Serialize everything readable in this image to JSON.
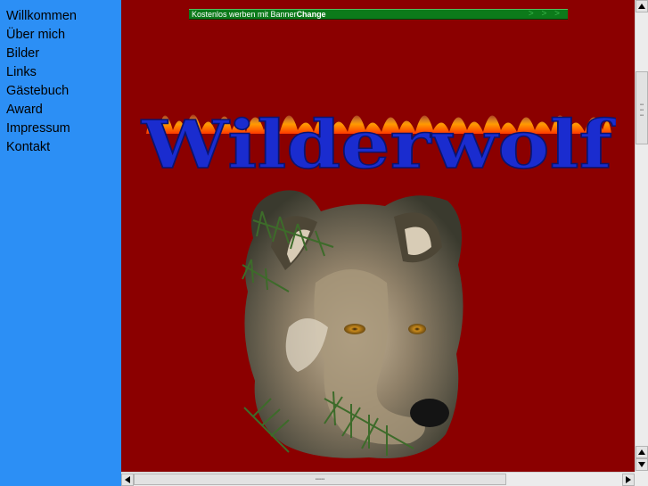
{
  "nav": {
    "items": [
      {
        "label": "Willkommen"
      },
      {
        "label": "Über mich"
      },
      {
        "label": "Bilder"
      },
      {
        "label": "Links"
      },
      {
        "label": "Gästebuch"
      },
      {
        "label": "Award"
      },
      {
        "label": "Impressum"
      },
      {
        "label": "Kontakt"
      }
    ]
  },
  "banner": {
    "text": "Kostenlos werben mit Banner",
    "brand": "Change",
    "arrows": "> > >"
  },
  "logo": {
    "text": "Wilderwolf"
  },
  "colors": {
    "nav_bg": "#2c8ff5",
    "main_bg": "#8b0000",
    "logo_fill": "#1a2ccf",
    "banner_bg": "#0c7a1a"
  },
  "icons": {
    "scroll_up": "triangle-up-icon",
    "scroll_down": "triangle-down-icon",
    "scroll_left": "triangle-left-icon",
    "scroll_right": "triangle-right-icon"
  }
}
